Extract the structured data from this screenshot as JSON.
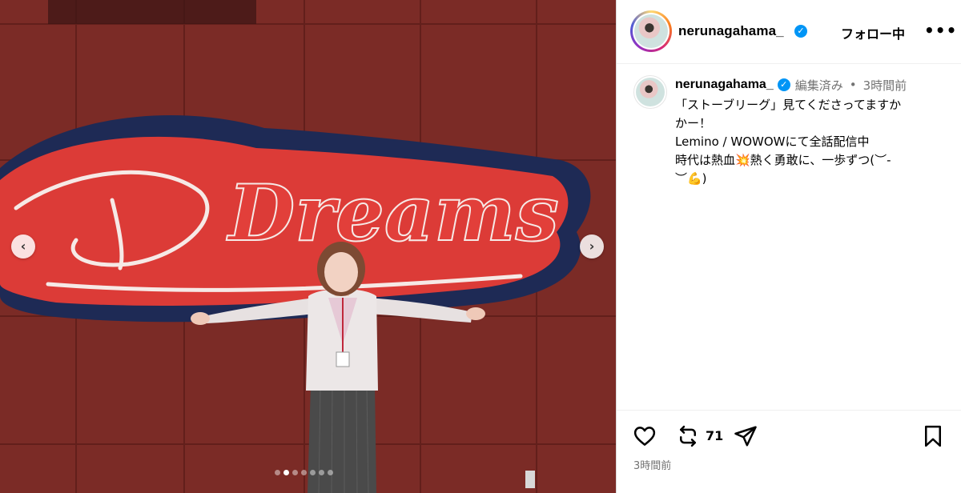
{
  "post": {
    "username": "nerunagahama_",
    "follow_label": "フォロー中",
    "more_label": "•••",
    "verified_mark": "✓"
  },
  "media": {
    "wall_sign_text": "Dreams",
    "carousel": {
      "total": 7,
      "active_index": 1
    },
    "prev_label": "‹",
    "next_label": "›"
  },
  "caption": {
    "edited_label": "編集済み",
    "separator": "•",
    "time_label": "3時間前",
    "lines": [
      "「ストーブリーグ」見てくださってますか",
      "かー！",
      "Lemino / WOWOWにて全話配信中",
      "時代は熱血💥熱く勇敢に、一歩ずつ(︶-",
      "︶💪)"
    ]
  },
  "actions": {
    "repost_count": "71",
    "timestamp": "3時間前"
  }
}
